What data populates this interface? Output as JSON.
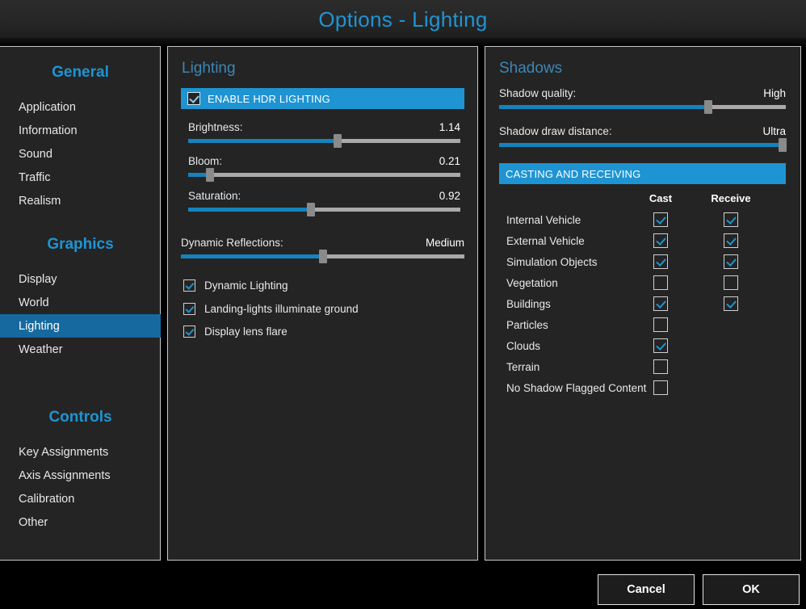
{
  "window": {
    "title": "Options - Lighting",
    "accent_color": "#1e94d2",
    "panel_bg": "#242424",
    "page_bg": "#000000"
  },
  "sidebar": {
    "groups": [
      {
        "title": "General",
        "items": [
          {
            "label": "Application",
            "selected": false
          },
          {
            "label": "Information",
            "selected": false
          },
          {
            "label": "Sound",
            "selected": false
          },
          {
            "label": "Traffic",
            "selected": false
          },
          {
            "label": "Realism",
            "selected": false
          }
        ]
      },
      {
        "title": "Graphics",
        "items": [
          {
            "label": "Display",
            "selected": false
          },
          {
            "label": "World",
            "selected": false
          },
          {
            "label": "Lighting",
            "selected": true
          },
          {
            "label": "Weather",
            "selected": false
          }
        ]
      },
      {
        "title": "Controls",
        "items": [
          {
            "label": "Key Assignments",
            "selected": false
          },
          {
            "label": "Axis Assignments",
            "selected": false
          },
          {
            "label": "Calibration",
            "selected": false
          },
          {
            "label": "Other",
            "selected": false
          }
        ]
      }
    ]
  },
  "lighting": {
    "heading": "Lighting",
    "hdr_toggle": {
      "label": "ENABLE HDR LIGHTING",
      "checked": true
    },
    "sliders": [
      {
        "label": "Brightness:",
        "value": "1.14",
        "percent": 55
      },
      {
        "label": "Bloom:",
        "value": "0.21",
        "percent": 8
      },
      {
        "label": "Saturation:",
        "value": "0.92",
        "percent": 45
      }
    ],
    "reflections": {
      "label": "Dynamic Reflections:",
      "value": "Medium",
      "percent": 50
    },
    "checkboxes": [
      {
        "label": "Dynamic Lighting",
        "checked": true
      },
      {
        "label": "Landing-lights illuminate ground",
        "checked": true
      },
      {
        "label": "Display lens flare",
        "checked": true
      }
    ]
  },
  "shadows": {
    "heading": "Shadows",
    "sliders": [
      {
        "label": "Shadow quality:",
        "value": "High",
        "percent": 73
      },
      {
        "label": "Shadow draw distance:",
        "value": "Ultra",
        "percent": 99
      }
    ],
    "section_header": "CASTING AND RECEIVING",
    "table": {
      "columns": [
        "Cast",
        "Receive"
      ],
      "rows": [
        {
          "name": "Internal Vehicle",
          "cast": true,
          "receive": true,
          "has_receive": true
        },
        {
          "name": "External Vehicle",
          "cast": true,
          "receive": true,
          "has_receive": true
        },
        {
          "name": "Simulation Objects",
          "cast": true,
          "receive": true,
          "has_receive": true
        },
        {
          "name": "Vegetation",
          "cast": false,
          "receive": false,
          "has_receive": true
        },
        {
          "name": "Buildings",
          "cast": true,
          "receive": true,
          "has_receive": true
        },
        {
          "name": "Particles",
          "cast": false,
          "receive": false,
          "has_receive": false
        },
        {
          "name": "Clouds",
          "cast": true,
          "receive": false,
          "has_receive": false
        },
        {
          "name": "Terrain",
          "cast": false,
          "receive": false,
          "has_receive": false
        },
        {
          "name": "No Shadow Flagged Content",
          "cast": false,
          "receive": false,
          "has_receive": false
        }
      ]
    }
  },
  "footer": {
    "cancel_label": "Cancel",
    "ok_label": "OK"
  }
}
